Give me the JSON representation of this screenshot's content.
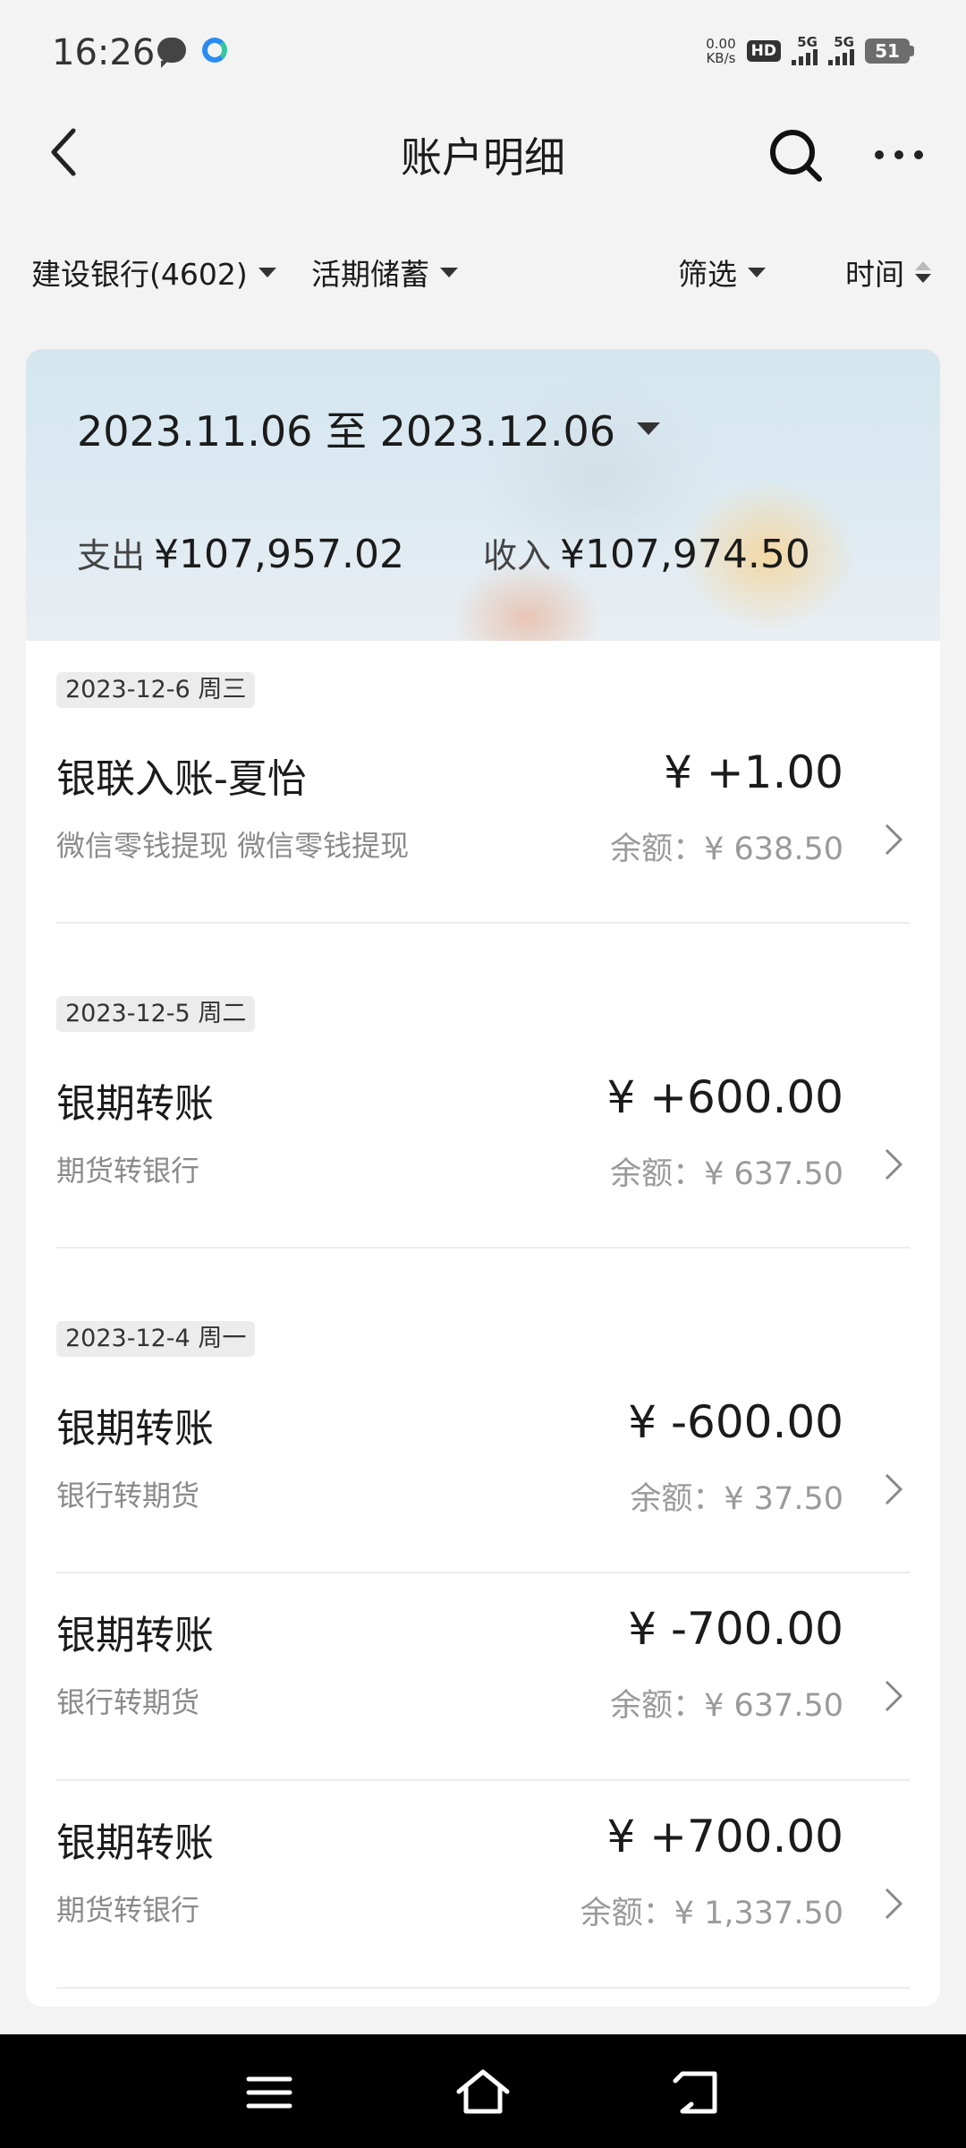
{
  "status_bar": {
    "time": "16:26",
    "net_speed_value": "0.00",
    "net_speed_unit": "KB/s",
    "hd_label": "HD",
    "sim1_label": "5G",
    "sim2_label": "5G",
    "battery_level": "51"
  },
  "header": {
    "title": "账户明细"
  },
  "filters": {
    "bank": "建设银行(4602)",
    "account_type": "活期储蓄",
    "filter_label": "筛选",
    "sort_label": "时间"
  },
  "summary": {
    "date_range": "2023.11.06 至 2023.12.06",
    "expense_label": "支出",
    "expense_value": "¥107,957.02",
    "income_label": "收入",
    "income_value": "¥107,974.50"
  },
  "transactions": [
    {
      "date_chip": "2023-12-6 周三",
      "title": "银联入账-夏怡",
      "amount": "¥ +1.00",
      "desc": "微信零钱提现 微信零钱提现",
      "balance": "余额：¥ 638.50"
    },
    {
      "date_chip": "2023-12-5 周二",
      "title": "银期转账",
      "amount": "¥ +600.00",
      "desc": "期货转银行",
      "balance": "余额：¥ 637.50"
    },
    {
      "date_chip": "2023-12-4 周一",
      "title": "银期转账",
      "amount": "¥ -600.00",
      "desc": "银行转期货",
      "balance": "余额：¥ 37.50"
    },
    {
      "date_chip": "",
      "title": "银期转账",
      "amount": "¥ -700.00",
      "desc": "银行转期货",
      "balance": "余额：¥ 637.50"
    },
    {
      "date_chip": "",
      "title": "银期转账",
      "amount": "¥ +700.00",
      "desc": "期货转银行",
      "balance": "余额：¥ 1,337.50"
    }
  ],
  "icons": {
    "back": "chevron-left-icon",
    "search": "search-icon",
    "more": "more-horizontal-icon",
    "row": "chevron-right-icon",
    "nav_menu": "menu-icon",
    "nav_home": "home-icon",
    "nav_back": "return-icon"
  }
}
